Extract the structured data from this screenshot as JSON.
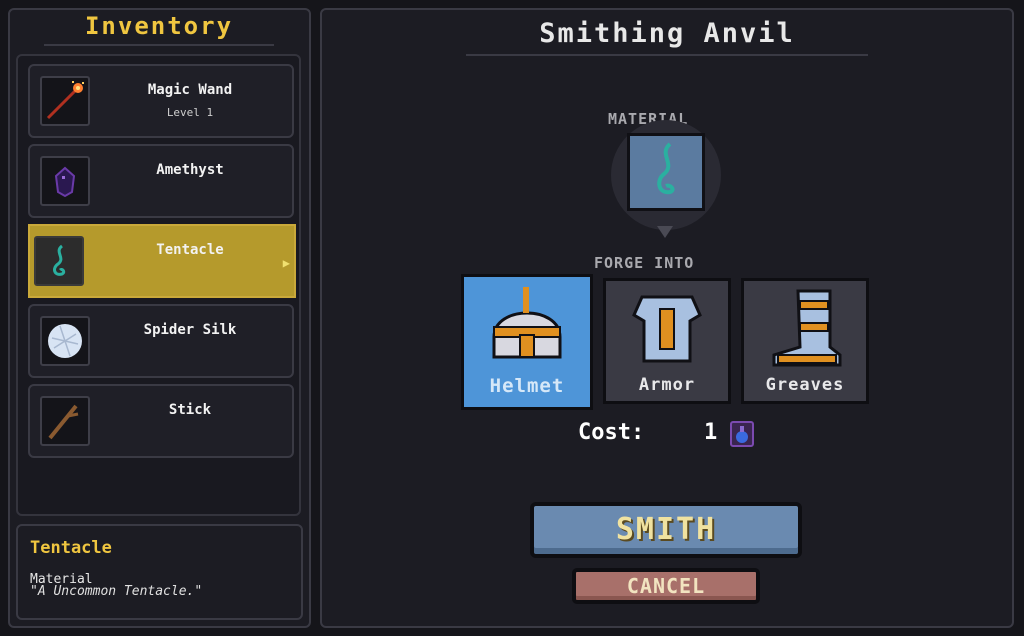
{
  "inventory": {
    "title": "Inventory",
    "items": [
      {
        "name": "Magic Wand",
        "sub": "Level 1",
        "icon": "magic-wand-icon"
      },
      {
        "name": "Amethyst",
        "sub": "",
        "icon": "amethyst-icon"
      },
      {
        "name": "Tentacle",
        "sub": "",
        "icon": "tentacle-icon",
        "selected": true
      },
      {
        "name": "Spider Silk",
        "sub": "",
        "icon": "spider-silk-icon"
      },
      {
        "name": "Stick",
        "sub": "",
        "icon": "stick-icon"
      }
    ],
    "selected_arrow": "▶"
  },
  "description": {
    "title": "Tentacle",
    "type": "Material",
    "text": "\"A Uncommon Tentacle.\""
  },
  "anvil": {
    "title": "Smithing Anvil",
    "material_label": "MATERIAL",
    "forge_label": "FORGE INTO",
    "options": [
      {
        "label": "Helmet",
        "icon": "helmet-icon",
        "active": true
      },
      {
        "label": "Armor",
        "icon": "armor-icon"
      },
      {
        "label": "Greaves",
        "icon": "greaves-icon"
      }
    ],
    "cost_label": "Cost:",
    "cost_value": "1",
    "smith_label": "SMITH",
    "cancel_label": "CANCEL"
  },
  "colors": {
    "accent_gold": "#f0c640",
    "selected_bg": "#b59a2c",
    "active_option": "#4e95d8",
    "smith_button": "#6a8ab0",
    "cancel_button": "#a8706a"
  }
}
